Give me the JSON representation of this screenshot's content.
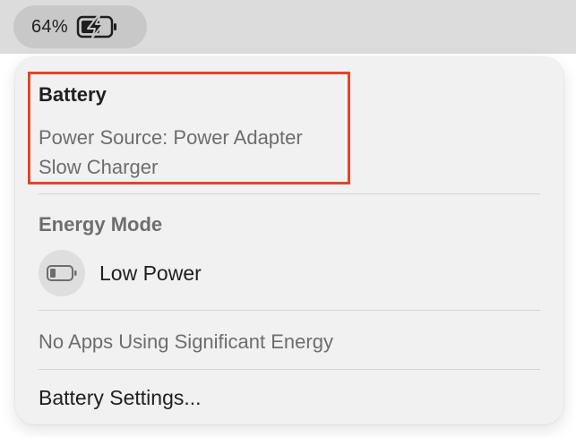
{
  "menubar": {
    "battery_percent": "64%",
    "battery_icon": "battery-charging-icon"
  },
  "panel": {
    "heading": "Battery",
    "power_source": "Power Source: Power Adapter",
    "charger": "Slow Charger",
    "energy_mode_heading": "Energy Mode",
    "low_power": {
      "label": "Low Power",
      "icon": "low-battery-icon"
    },
    "apps_status": "No Apps Using Significant Energy",
    "settings_label": "Battery Settings..."
  },
  "colors": {
    "highlight": "#e1462c",
    "panel_bg": "#f1f1f1",
    "menubar_bg": "#dcdcdc"
  }
}
